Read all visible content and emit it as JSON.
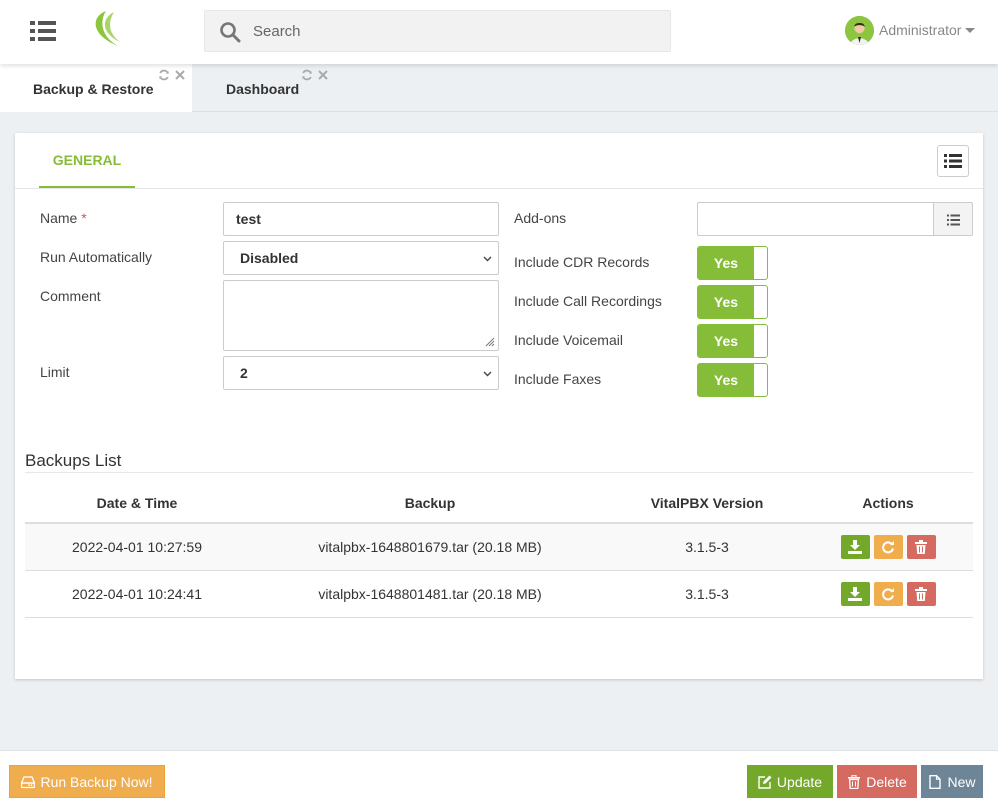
{
  "search": {
    "placeholder": "Search"
  },
  "user": {
    "name": "Administrator"
  },
  "tabs": [
    {
      "label": "Backup & Restore"
    },
    {
      "label": "Dashboard"
    }
  ],
  "panel": {
    "tab_general": "GENERAL"
  },
  "form": {
    "name_label": "Name",
    "required_mark": "*",
    "name_value": "test",
    "run_auto_label": "Run Automatically",
    "run_auto_value": "Disabled",
    "comment_label": "Comment",
    "comment_value": "",
    "limit_label": "Limit",
    "limit_value": "2",
    "addons_label": "Add-ons",
    "addons_value": "",
    "cdr_label": "Include CDR Records",
    "cdr_value": "Yes",
    "recordings_label": "Include Call Recordings",
    "recordings_value": "Yes",
    "voicemail_label": "Include Voicemail",
    "voicemail_value": "Yes",
    "faxes_label": "Include Faxes",
    "faxes_value": "Yes"
  },
  "backups": {
    "title": "Backups List",
    "headers": {
      "date": "Date & Time",
      "backup": "Backup",
      "version": "VitalPBX Version",
      "actions": "Actions"
    },
    "rows": [
      {
        "date": "2022-04-01 10:27:59",
        "backup": "vitalpbx-1648801679.tar (20.18 MB)",
        "version": "3.1.5-3"
      },
      {
        "date": "2022-04-01 10:24:41",
        "backup": "vitalpbx-1648801481.tar (20.18 MB)",
        "version": "3.1.5-3"
      }
    ]
  },
  "footer": {
    "run_backup": "Run Backup Now!",
    "update": "Update",
    "delete": "Delete",
    "new": "New"
  },
  "colors": {
    "accent_green": "#86bd38",
    "button_green": "#74a82a",
    "button_orange": "#f0ad4e",
    "button_red": "#d56b60",
    "button_slate": "#6d8596"
  }
}
